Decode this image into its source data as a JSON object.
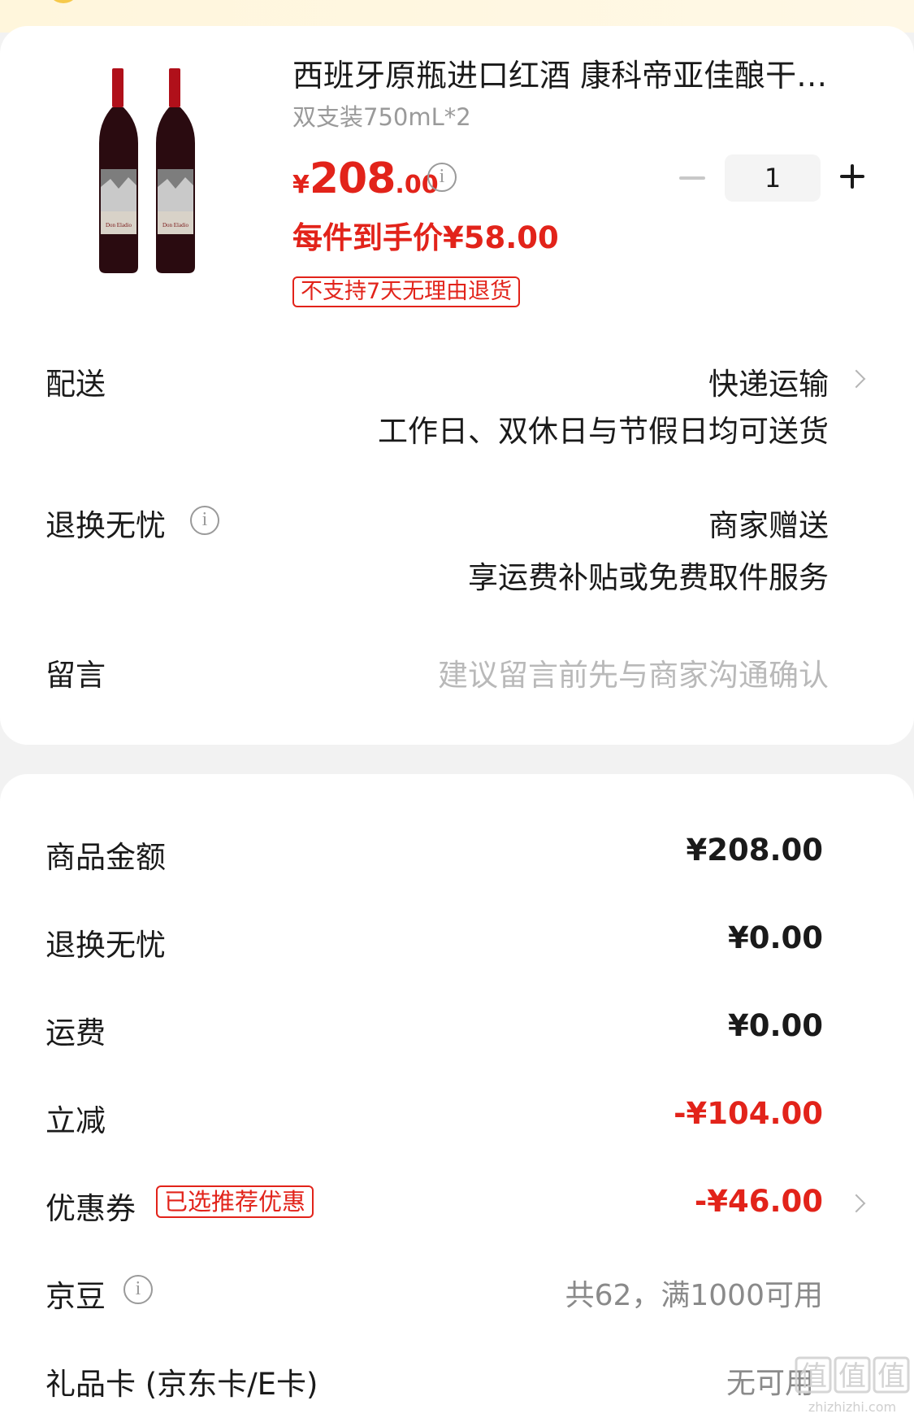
{
  "product": {
    "title": "西班牙原瓶进口红酒 康科帝亚佳酿干…",
    "spec": "双支装750mL*2",
    "price_symbol": "¥",
    "price_int": "208",
    "price_dec": ".00",
    "unit_price": "每件到手价¥58.00",
    "return_policy": "不支持7天无理由退货",
    "quantity": "1"
  },
  "shipping": {
    "label": "配送",
    "method": "快递运输",
    "note": "工作日、双休日与节假日均可送货"
  },
  "return_worry_free": {
    "label": "退换无忧",
    "value": "商家赠送",
    "note": "享运费补贴或免费取件服务"
  },
  "message": {
    "label": "留言",
    "placeholder": "建议留言前先与商家沟通确认"
  },
  "summary": {
    "goods_amount": {
      "label": "商品金额",
      "value": "¥208.00"
    },
    "return_fee": {
      "label": "退换无忧",
      "value": "¥0.00"
    },
    "freight": {
      "label": "运费",
      "value": "¥0.00"
    },
    "instant_discount": {
      "label": "立减",
      "value": "-¥104.00"
    },
    "coupon": {
      "label": "优惠券",
      "tag": "已选推荐优惠",
      "value": "-¥46.00"
    },
    "beans": {
      "label": "京豆",
      "value": "共62，满1000可用"
    },
    "gift_card": {
      "label": "礼品卡 (京东卡/E卡)",
      "value": "无可用"
    }
  },
  "watermark": {
    "text": "值",
    "domain": "zhizhizhi.com"
  },
  "colors": {
    "accent": "#e2231a",
    "muted": "#9a9a9a",
    "top_band": "#fff6dc"
  }
}
